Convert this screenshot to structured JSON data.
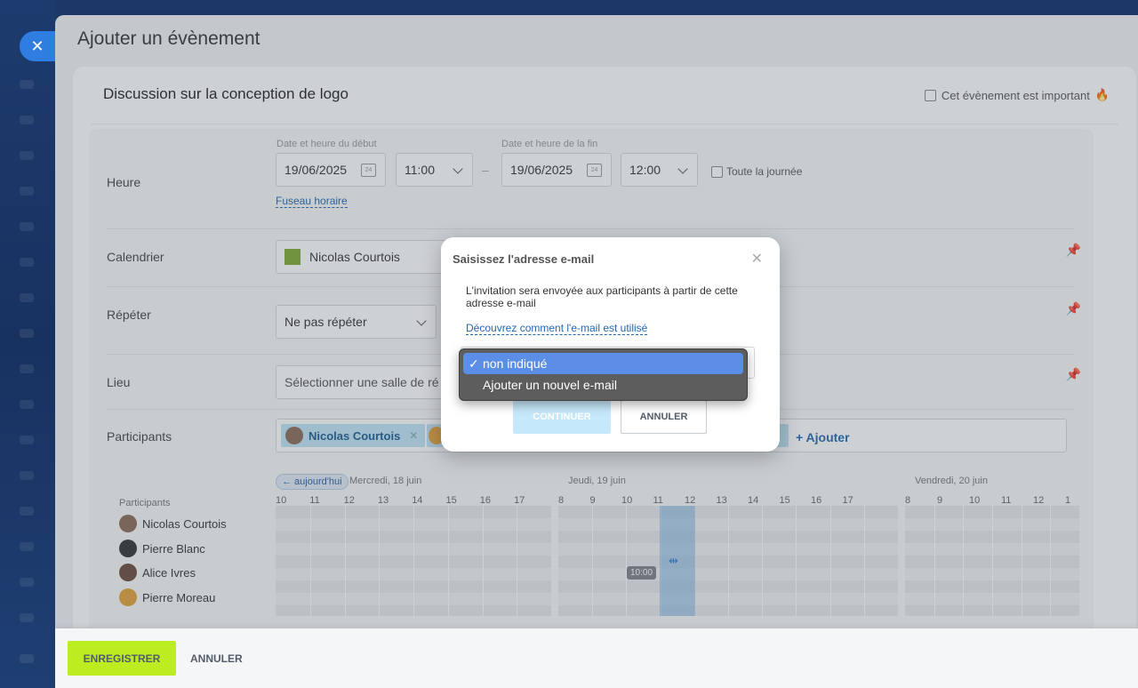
{
  "panel": {
    "title": "Ajouter un évènement"
  },
  "event": {
    "title": "Discussion sur la conception de logo",
    "important_label": "Cet évènement est important"
  },
  "time": {
    "label": "Heure",
    "start_caption": "Date et heure du début",
    "end_caption": "Date et heure de la fin",
    "start_date": "19/06/2025",
    "start_time": "11:00",
    "end_date": "19/06/2025",
    "end_time": "12:00",
    "all_day_label": "Toute la journée",
    "timezone_link": "Fuseau horaire",
    "calendar_icon_day": "24"
  },
  "calendar": {
    "label": "Calendrier",
    "value": "Nicolas Courtois",
    "color": "#7fa830"
  },
  "repeat": {
    "label": "Répéter",
    "value": "Ne pas répéter"
  },
  "location": {
    "label": "Lieu",
    "placeholder": "Sélectionner une salle de ré"
  },
  "participants": {
    "label": "Participants",
    "chip_name": "Nicolas Courtois",
    "add_label": "+ Ajouter"
  },
  "planner": {
    "today_button": "← aujourd'hui",
    "days": [
      "Mercredi, 18 juin",
      "Jeudi, 19 juin",
      "Vendredi, 20 juin"
    ],
    "hours_day1": [
      "10",
      "11",
      "12",
      "13",
      "14",
      "15",
      "16",
      "17"
    ],
    "hours_day2": [
      "8",
      "9",
      "10",
      "11",
      "12",
      "13",
      "14",
      "15",
      "16",
      "17"
    ],
    "hours_day3": [
      "8",
      "9",
      "10",
      "11",
      "12",
      "1"
    ],
    "participants_header": "Participants",
    "people": [
      "Nicolas Courtois",
      "Pierre Blanc",
      "Alice Ivres",
      "Pierre Moreau"
    ],
    "time_tag": "10:00"
  },
  "footer": {
    "save": "ENREGISTRER",
    "cancel": "ANNULER"
  },
  "popup": {
    "title": "Saisissez l'adresse e-mail",
    "text": "L'invitation sera envoyée aux participants à partir de cette adresse e-mail",
    "link": "Découvrez comment l'e-mail est utilisé",
    "continue": "CONTINUER",
    "cancel": "ANNULER",
    "options": [
      "non indiqué",
      "Ajouter un nouvel e-mail"
    ],
    "selected_option": "non indiqué"
  },
  "colors": {
    "accent": "#2067b0",
    "save_button": "#bbed21",
    "selection": "#5b8ee6"
  }
}
